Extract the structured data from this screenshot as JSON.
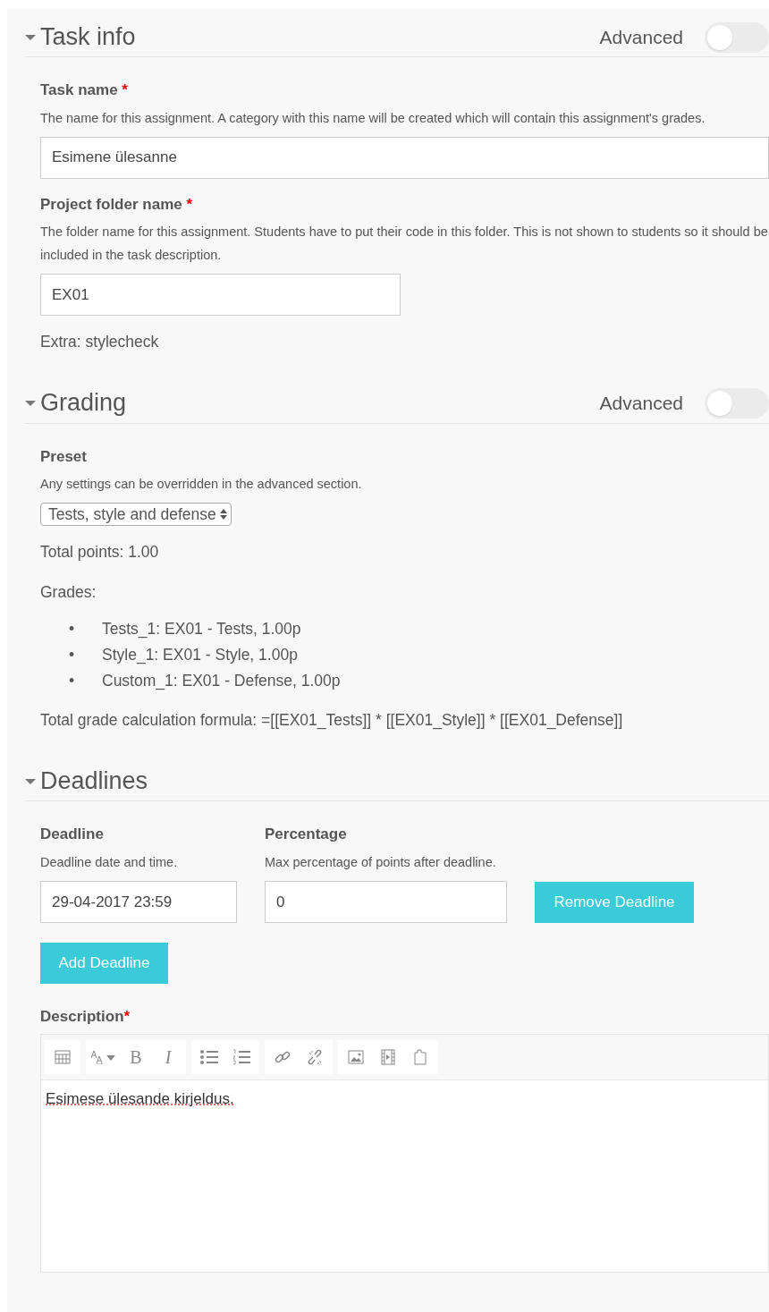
{
  "sections": [
    {
      "title": "Task info",
      "expanded": true,
      "advanced": {
        "label": "Advanced",
        "on": false
      },
      "items": [
        {
          "kind": "wide_field",
          "label": "Task name",
          "required_mark": "*",
          "help": "The name for this assignment. A category with this name will be created which will contain this assignment's grades.",
          "value": "Esimene ülesanne"
        },
        {
          "kind": "short_field",
          "label": "Project folder name",
          "required_mark": "*",
          "help": "The folder name for this assignment. Students have to put their code in this folder. This is not shown to students so it should be included in the task description.",
          "value": "EX01"
        },
        {
          "kind": "text",
          "text": "Extra: stylecheck"
        }
      ]
    },
    {
      "title": "Grading",
      "expanded": true,
      "advanced": {
        "label": "Advanced",
        "on": false
      },
      "items": [
        {
          "kind": "select",
          "label": "Preset",
          "help": "Any settings can be overridden in the advanced section.",
          "value": "Tests, style and defense"
        },
        {
          "kind": "text",
          "text": "Total points: 1.00"
        },
        {
          "kind": "text",
          "text": "Grades:"
        },
        {
          "kind": "list",
          "entries": [
            {
              "marker": "•",
              "text": "Tests_1: EX01 - Tests, 1.00p"
            },
            {
              "marker": "•",
              "text": "Style_1: EX01 - Style, 1.00p"
            },
            {
              "marker": "•",
              "text": "Custom_1: EX01 - Defense, 1.00p"
            }
          ]
        },
        {
          "kind": "text",
          "text": "Total grade calculation formula: =[[EX01_Tests]] * [[EX01_Style]] * [[EX01_Defense]]"
        }
      ]
    },
    {
      "title": "Deadlines",
      "expanded": true,
      "items": [
        {
          "kind": "deadline",
          "columns": [
            {
              "label": "Deadline",
              "help": "Deadline date and time.",
              "value": "29-04-2017 23:59"
            },
            {
              "label": "Percentage",
              "help": "Max percentage of points after deadline.",
              "value": "0"
            }
          ],
          "button": "Remove Deadline"
        },
        {
          "kind": "button",
          "text": "Add Deadline"
        },
        {
          "kind": "editor",
          "label": "Description",
          "required_mark": "*",
          "toolbar": [
            [
              {
                "kind": "table"
              }
            ],
            [
              {
                "kind": "font_size"
              },
              {
                "kind": "bold",
                "label": "B"
              },
              {
                "kind": "italic",
                "label": "I"
              }
            ],
            [
              {
                "kind": "bullets"
              },
              {
                "kind": "numbers"
              }
            ],
            [
              {
                "kind": "link"
              },
              {
                "kind": "unlink"
              }
            ],
            [
              {
                "kind": "image"
              },
              {
                "kind": "video"
              },
              {
                "kind": "file"
              }
            ]
          ],
          "value": "Esimese ülesande kirjeldus."
        }
      ]
    }
  ]
}
